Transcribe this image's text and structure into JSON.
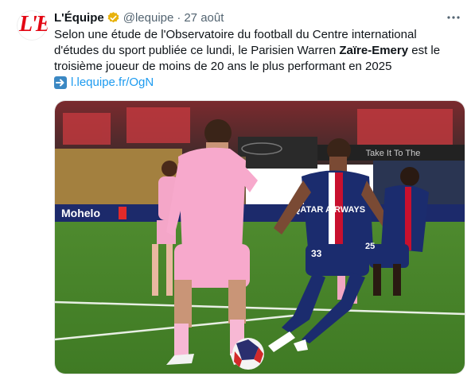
{
  "account": {
    "name": "L'Équipe",
    "handle": "@lequipe",
    "separator": "·",
    "date": "27 août",
    "avatar_letter": "L'E",
    "verified_color": "#e8b20c"
  },
  "tweet": {
    "text_part1": "Selon une étude de l'Observatoire du football du Centre international d'études du sport publiée ce lundi, le Parisien Warren ",
    "text_bold": "Zaïre-Emery",
    "text_part2": " est le troisième joueur de moins de 20 ans le plus performant en 2025",
    "link_icon": "right-arrow-icon",
    "link": "l.lequipe.fr/OgN"
  },
  "media": {
    "description_icon": "football-photo",
    "stadium_banner": "Mohelo",
    "stadium_sign": "Take It To The",
    "shirt_sponsor": "QATAR AIRWAYS",
    "shirt_number_a": "33",
    "shirt_number_b": "25"
  },
  "colors": {
    "link": "#1d9bf0",
    "secondary_text": "#536471",
    "brand_red": "#e30613"
  }
}
